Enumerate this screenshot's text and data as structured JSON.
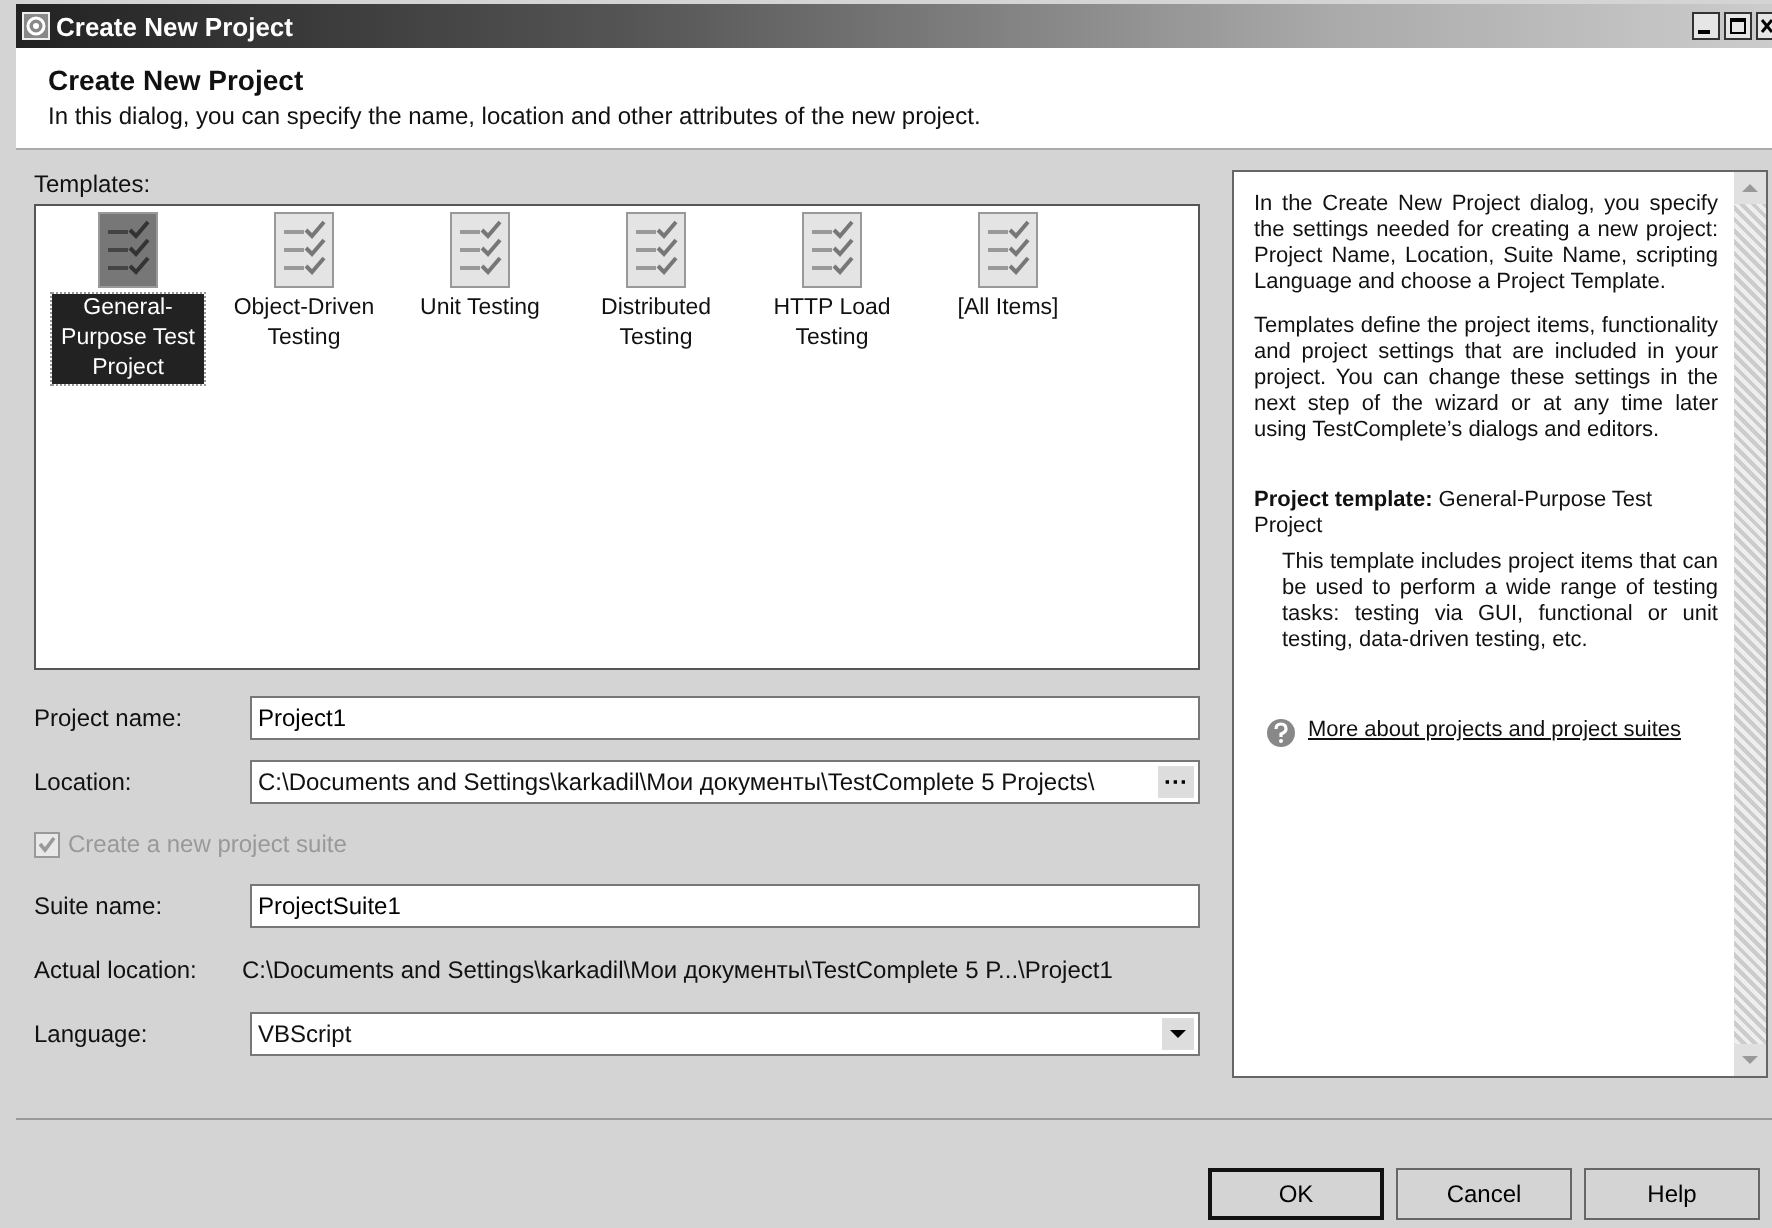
{
  "window": {
    "title": "Create New Project"
  },
  "header": {
    "title": "Create New Project",
    "description": "In this dialog, you can specify the name, location and other attributes of the new project."
  },
  "templates": {
    "label": "Templates:",
    "items": [
      {
        "label": "General-Purpose Test Project",
        "selected": true
      },
      {
        "label": "Object-Driven Testing",
        "selected": false
      },
      {
        "label": "Unit Testing",
        "selected": false
      },
      {
        "label": "Distributed Testing",
        "selected": false
      },
      {
        "label": "HTTP Load Testing",
        "selected": false
      },
      {
        "label": "[All Items]",
        "selected": false
      }
    ]
  },
  "form": {
    "project_name": {
      "label": "Project name:",
      "value": "Project1"
    },
    "location": {
      "label": "Location:",
      "value": "C:\\Documents and Settings\\karkadil\\Мои документы\\TestComplete 5 Projects\\",
      "browse": "···"
    },
    "create_suite": {
      "label": "Create a new project suite",
      "checked": true,
      "disabled": true
    },
    "suite_name": {
      "label": "Suite name:",
      "value": "ProjectSuite1"
    },
    "actual_location": {
      "label": "Actual location:",
      "value": "C:\\Documents and Settings\\karkadil\\Мои документы\\TestComplete 5 P...\\Project1"
    },
    "language": {
      "label": "Language:",
      "value": "VBScript"
    }
  },
  "info": {
    "paragraphs": [
      "In the Create New Project dialog, you specify the settings needed for creating a new project: Project Name, Location, Suite Name, scripting Language and choose a Project Template.",
      "Templates define the project items, functionality and project settings that are included in your project. You can change these settings in the next step of the wizard or at any time later using TestComplete’s dialogs and editors."
    ],
    "template_heading": "**Project template:** General-Purpose Test Project",
    "template_description": "This template includes project items that can be used to perform a wide range of testing tasks: testing via GUI, functional or unit testing, data-driven testing, etc.",
    "link": "More about projects and project suites"
  },
  "buttons": [
    {
      "label": "OK",
      "default": true
    },
    {
      "label": "Cancel",
      "default": false
    },
    {
      "label": "Help",
      "default": false
    }
  ]
}
